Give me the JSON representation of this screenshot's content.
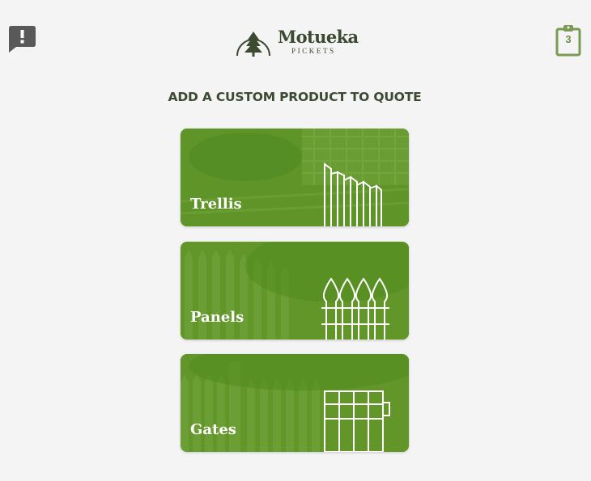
{
  "header": {
    "brand_name": "Motueka",
    "brand_sub": "PICKETS",
    "quote_count": "3",
    "feedback_icon": "feedback-alert-icon",
    "quote_icon": "clipboard-icon"
  },
  "main": {
    "title": "ADD A CUSTOM PRODUCT TO QUOTE",
    "products": [
      {
        "label": "Trellis",
        "icon": "trellis-icon"
      },
      {
        "label": "Panels",
        "icon": "picket-panel-icon"
      },
      {
        "label": "Gates",
        "icon": "gate-icon"
      }
    ]
  },
  "colors": {
    "background": "#f4f4f4",
    "card_green": "#62952c",
    "brand_dark": "#3b4a30",
    "icon_gray": "#595959",
    "clipboard_green": "#6f8f45"
  }
}
